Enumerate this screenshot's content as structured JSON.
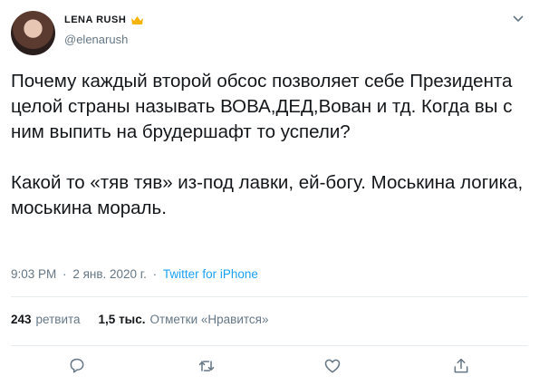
{
  "user": {
    "display_name": "LENA RUSH",
    "handle": "@elenarush"
  },
  "tweet": {
    "text": "Почему каждый второй обсос позволяет себе Президента целой страны называть ВОВА,ДЕД,Вован и тд. Когда вы с ним выпить на брудершафт то успели?\n\nКакой то «тяв тяв» из-под лавки, ей-богу. Моськина логика, моськина мораль."
  },
  "meta": {
    "time": "9:03 PM",
    "separator_1": "·",
    "date": "2 янв. 2020 г.",
    "separator_2": "·",
    "source": "Twitter for iPhone"
  },
  "stats": {
    "retweets_count": "243",
    "retweets_label": "ретвита",
    "likes_count": "1,5 тыс.",
    "likes_label": "Отметки «Нравится»"
  },
  "actions": {
    "reply_icon": "reply-icon",
    "retweet_icon": "retweet-icon",
    "like_icon": "heart-icon",
    "share_icon": "share-icon"
  },
  "colors": {
    "text": "#14171a",
    "secondary": "#657786",
    "link": "#1da1f2",
    "divider": "#e6ecf0",
    "crown": "#f5b400"
  }
}
